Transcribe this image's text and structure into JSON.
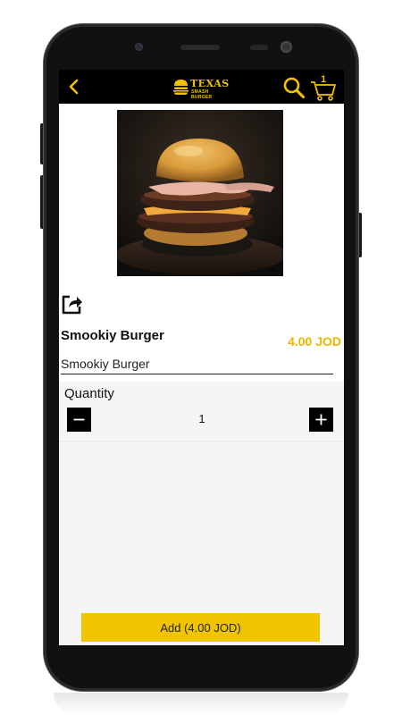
{
  "app": {
    "logo_title": "TEXAS",
    "logo_subtitle": "SMASH BURGER",
    "cart_count": "1",
    "accent_color": "#f2c200"
  },
  "icons": {
    "back": "chevron-left-icon",
    "search": "search-icon",
    "cart": "cart-icon",
    "share": "share-icon",
    "minus": "minus-icon",
    "plus": "plus-icon"
  },
  "product": {
    "name": "Smookiy Burger",
    "price": "4.00 JOD",
    "description": "Smookiy Burger"
  },
  "quantity": {
    "label": "Quantity",
    "value": "1"
  },
  "actions": {
    "add_label": "Add (4.00 JOD)"
  }
}
